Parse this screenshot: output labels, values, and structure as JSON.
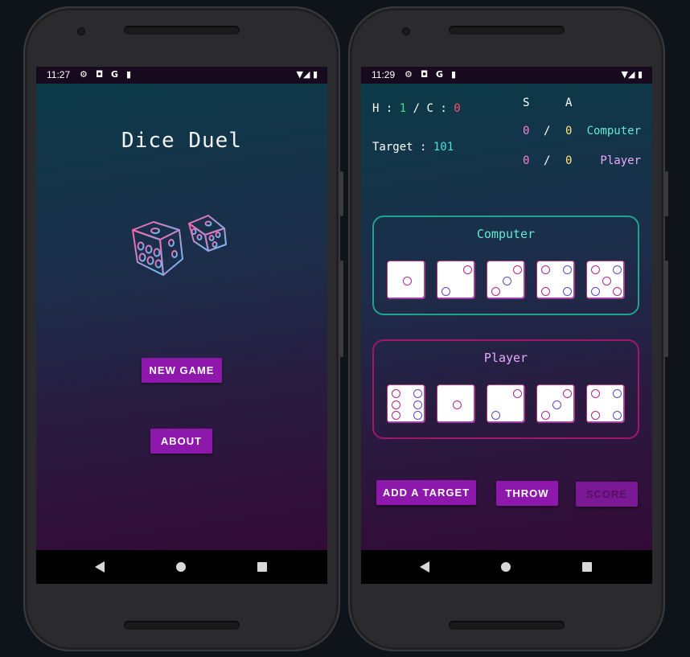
{
  "left_phone": {
    "status": {
      "time": "11:27"
    },
    "title": "Dice Duel",
    "buttons": {
      "new_game": "NEW GAME",
      "about": "ABOUT"
    }
  },
  "right_phone": {
    "status": {
      "time": "11:29"
    },
    "rounds": {
      "h_label": "H :",
      "h_value": "1",
      "sep": "/",
      "c_label": "C :",
      "c_value": "0"
    },
    "target": {
      "label": "Target :",
      "value": "101"
    },
    "table": {
      "col_s": "S",
      "col_a": "A",
      "computer": {
        "s": "0",
        "slash": "/",
        "a": "0",
        "name": "Computer"
      },
      "player": {
        "s": "0",
        "slash": "/",
        "a": "0",
        "name": "Player"
      }
    },
    "computer_panel": {
      "title": "Computer",
      "dice": [
        1,
        2,
        3,
        4,
        5
      ]
    },
    "player_panel": {
      "title": "Player",
      "dice": [
        6,
        1,
        2,
        3,
        4
      ]
    },
    "buttons": {
      "add_target": "ADD A TARGET",
      "throw": "THROW",
      "score": "SCORE"
    }
  },
  "colors": {
    "accent": "#8e18ab",
    "computer_border": "#1fa38c",
    "player_border": "#a0186a"
  },
  "icons": [
    "settings-icon",
    "a-icon",
    "google-icon",
    "sd-card-icon",
    "wifi-icon",
    "signal-icon",
    "battery-icon",
    "dice-logo-icon",
    "nav-back-icon",
    "nav-home-icon",
    "nav-recents-icon"
  ]
}
